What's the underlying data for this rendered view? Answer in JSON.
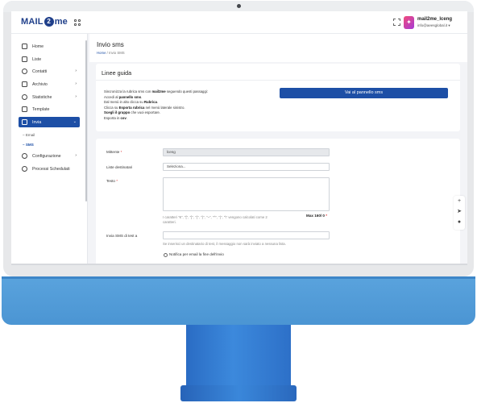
{
  "app": {
    "logo_left": "MAIL",
    "logo_mid": "2",
    "logo_right": "me"
  },
  "user": {
    "initial": "✦",
    "name": "mail2me_lceng",
    "email": "info@aeesglobal.it ▾"
  },
  "sidebar": {
    "items": [
      {
        "label": "Home",
        "icon": "home-icon"
      },
      {
        "label": "Liste",
        "icon": "list-icon"
      },
      {
        "label": "Contatti",
        "icon": "contacts-icon"
      },
      {
        "label": "Archivio",
        "icon": "archive-icon"
      },
      {
        "label": "Statistiche",
        "icon": "stats-icon"
      },
      {
        "label": "Template",
        "icon": "template-icon"
      },
      {
        "label": "Invia",
        "icon": "send-icon"
      },
      {
        "label": "Configurazione",
        "icon": "gear-icon"
      },
      {
        "label": "Processi Schedulati",
        "icon": "refresh-icon"
      }
    ],
    "sub_items": [
      "Email",
      "SMS"
    ]
  },
  "page": {
    "title": "Invio sms",
    "breadcrumb_home": "Home",
    "breadcrumb_sep": "/",
    "breadcrumb_current": "Invio SMS"
  },
  "guide": {
    "title": "Linee guida",
    "line1_a": "Sincronizza la rubrica sms con ",
    "line1_b": "mail2me",
    "line1_c": " seguendo questi passaggi:",
    "line2_a": "Accedi al ",
    "line2_b": "pannello sms",
    "line2_c": ".",
    "line3_a": "Dal menù in alto clicca su ",
    "line3_b": "Rubrica",
    "line3_c": ".",
    "line4_a": "Clicca su ",
    "line4_b": "Esporta rubrica",
    "line4_c": " nel menù laterale sinistro.",
    "line5_a": "Scegli il gruppo",
    "line5_b": " che vuoi esportare.",
    "line6_a": "Esporta in ",
    "line6_b": "csv",
    "line6_c": ".",
    "button": "Vai al pannello sms"
  },
  "form": {
    "sender_label": "Mittente",
    "sender_value": "lceng",
    "list_label": "Liste destinatari",
    "list_placeholder": "Seleziona...",
    "text_label": "Testo",
    "text_note_1": "I caratteri \"€\", \"[\", \"]\", \"{\", \"}\", \"~\", \"^\", \"|\", \"\\\" vengono calcolati come 2",
    "text_note_2": "caratteri.",
    "max_chars": "Max 160/ 0",
    "test_label": "Invia SMS di test a",
    "test_note": "Se inserisci un destinatario di test, il messaggio non sarà inviato a nessuna lista.",
    "notify_label": "Notifica per email la fine dell'invio",
    "required_mark": "*"
  },
  "colors": {
    "primary": "#1d4fa6",
    "stand": "#3a87da"
  }
}
